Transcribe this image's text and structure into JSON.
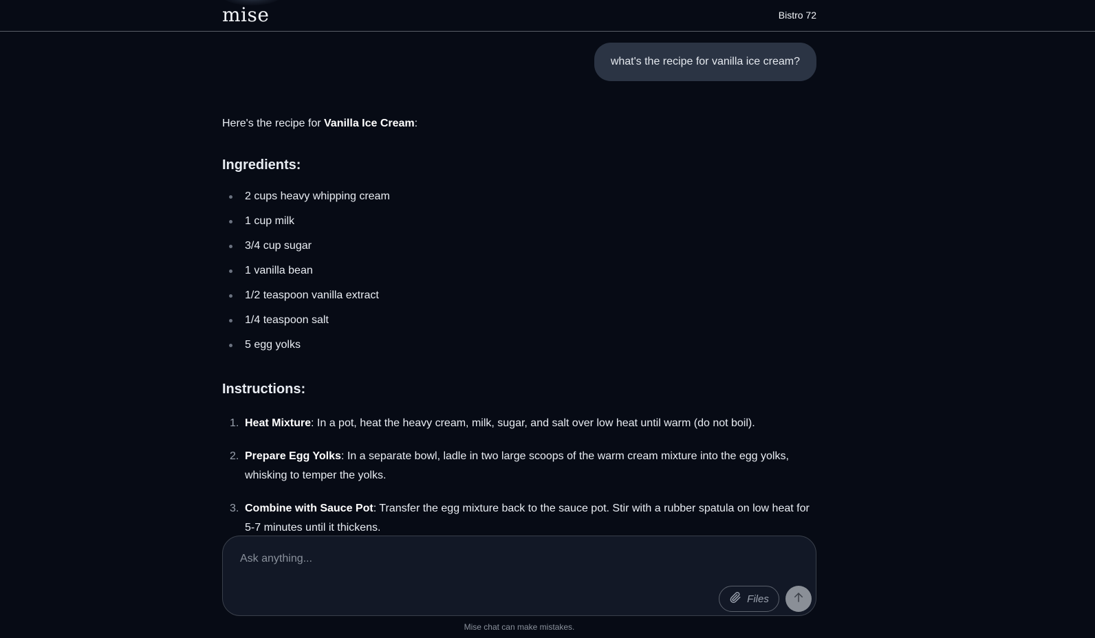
{
  "header": {
    "logo": "mise",
    "restaurant": "Bistro 72"
  },
  "user_message": "what's the recipe for vanilla ice cream?",
  "assistant": {
    "intro_prefix": "Here's the recipe for ",
    "intro_bold": "Vanilla Ice Cream",
    "intro_suffix": ":",
    "ingredients_heading": "Ingredients:",
    "ingredients": [
      "2 cups heavy whipping cream",
      "1 cup milk",
      "3/4 cup sugar",
      "1 vanilla bean",
      "1/2 teaspoon vanilla extract",
      "1/4 teaspoon salt",
      "5 egg yolks"
    ],
    "instructions_heading": "Instructions:",
    "instructions": [
      {
        "num": "1.",
        "title": "Heat Mixture",
        "text": ": In a pot, heat the heavy cream, milk, sugar, and salt over low heat until warm (do not boil)."
      },
      {
        "num": "2.",
        "title": "Prepare Egg Yolks",
        "text": ": In a separate bowl, ladle in two large scoops of the warm cream mixture into the egg yolks, whisking to temper the yolks."
      },
      {
        "num": "3.",
        "title": "Combine with Sauce Pot",
        "text": ": Transfer the egg mixture back to the sauce pot. Stir with a rubber spatula on low heat for 5-7 minutes until it thickens."
      }
    ]
  },
  "composer": {
    "placeholder": "Ask anything...",
    "files_label": "Files",
    "attach_icon": "paperclip-icon",
    "send_icon": "arrow-up-icon"
  },
  "footer": {
    "disclaimer": "Mise chat can make mistakes."
  },
  "colors": {
    "background": "#070b15",
    "user_bubble": "#2b3444",
    "composer_bg": "#121826",
    "send_button": "#8a8f97"
  }
}
